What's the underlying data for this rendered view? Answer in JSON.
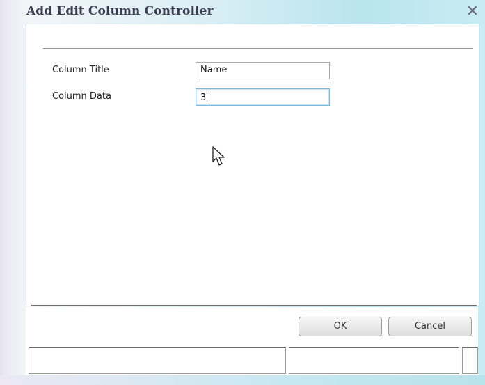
{
  "dialog": {
    "title": "Add Edit Column Controller",
    "close_glyph": "✕"
  },
  "form": {
    "column_title_label": "Column Title",
    "column_title_value": "Name",
    "column_data_label": "Column Data",
    "column_data_value": "3"
  },
  "buttons": {
    "ok_label": "OK",
    "cancel_label": "Cancel"
  },
  "icons": [
    "close-icon",
    "mouse-pointer-icon"
  ],
  "colors": {
    "focus_border": "#7ab8de",
    "title_text": "#3d3d52"
  }
}
